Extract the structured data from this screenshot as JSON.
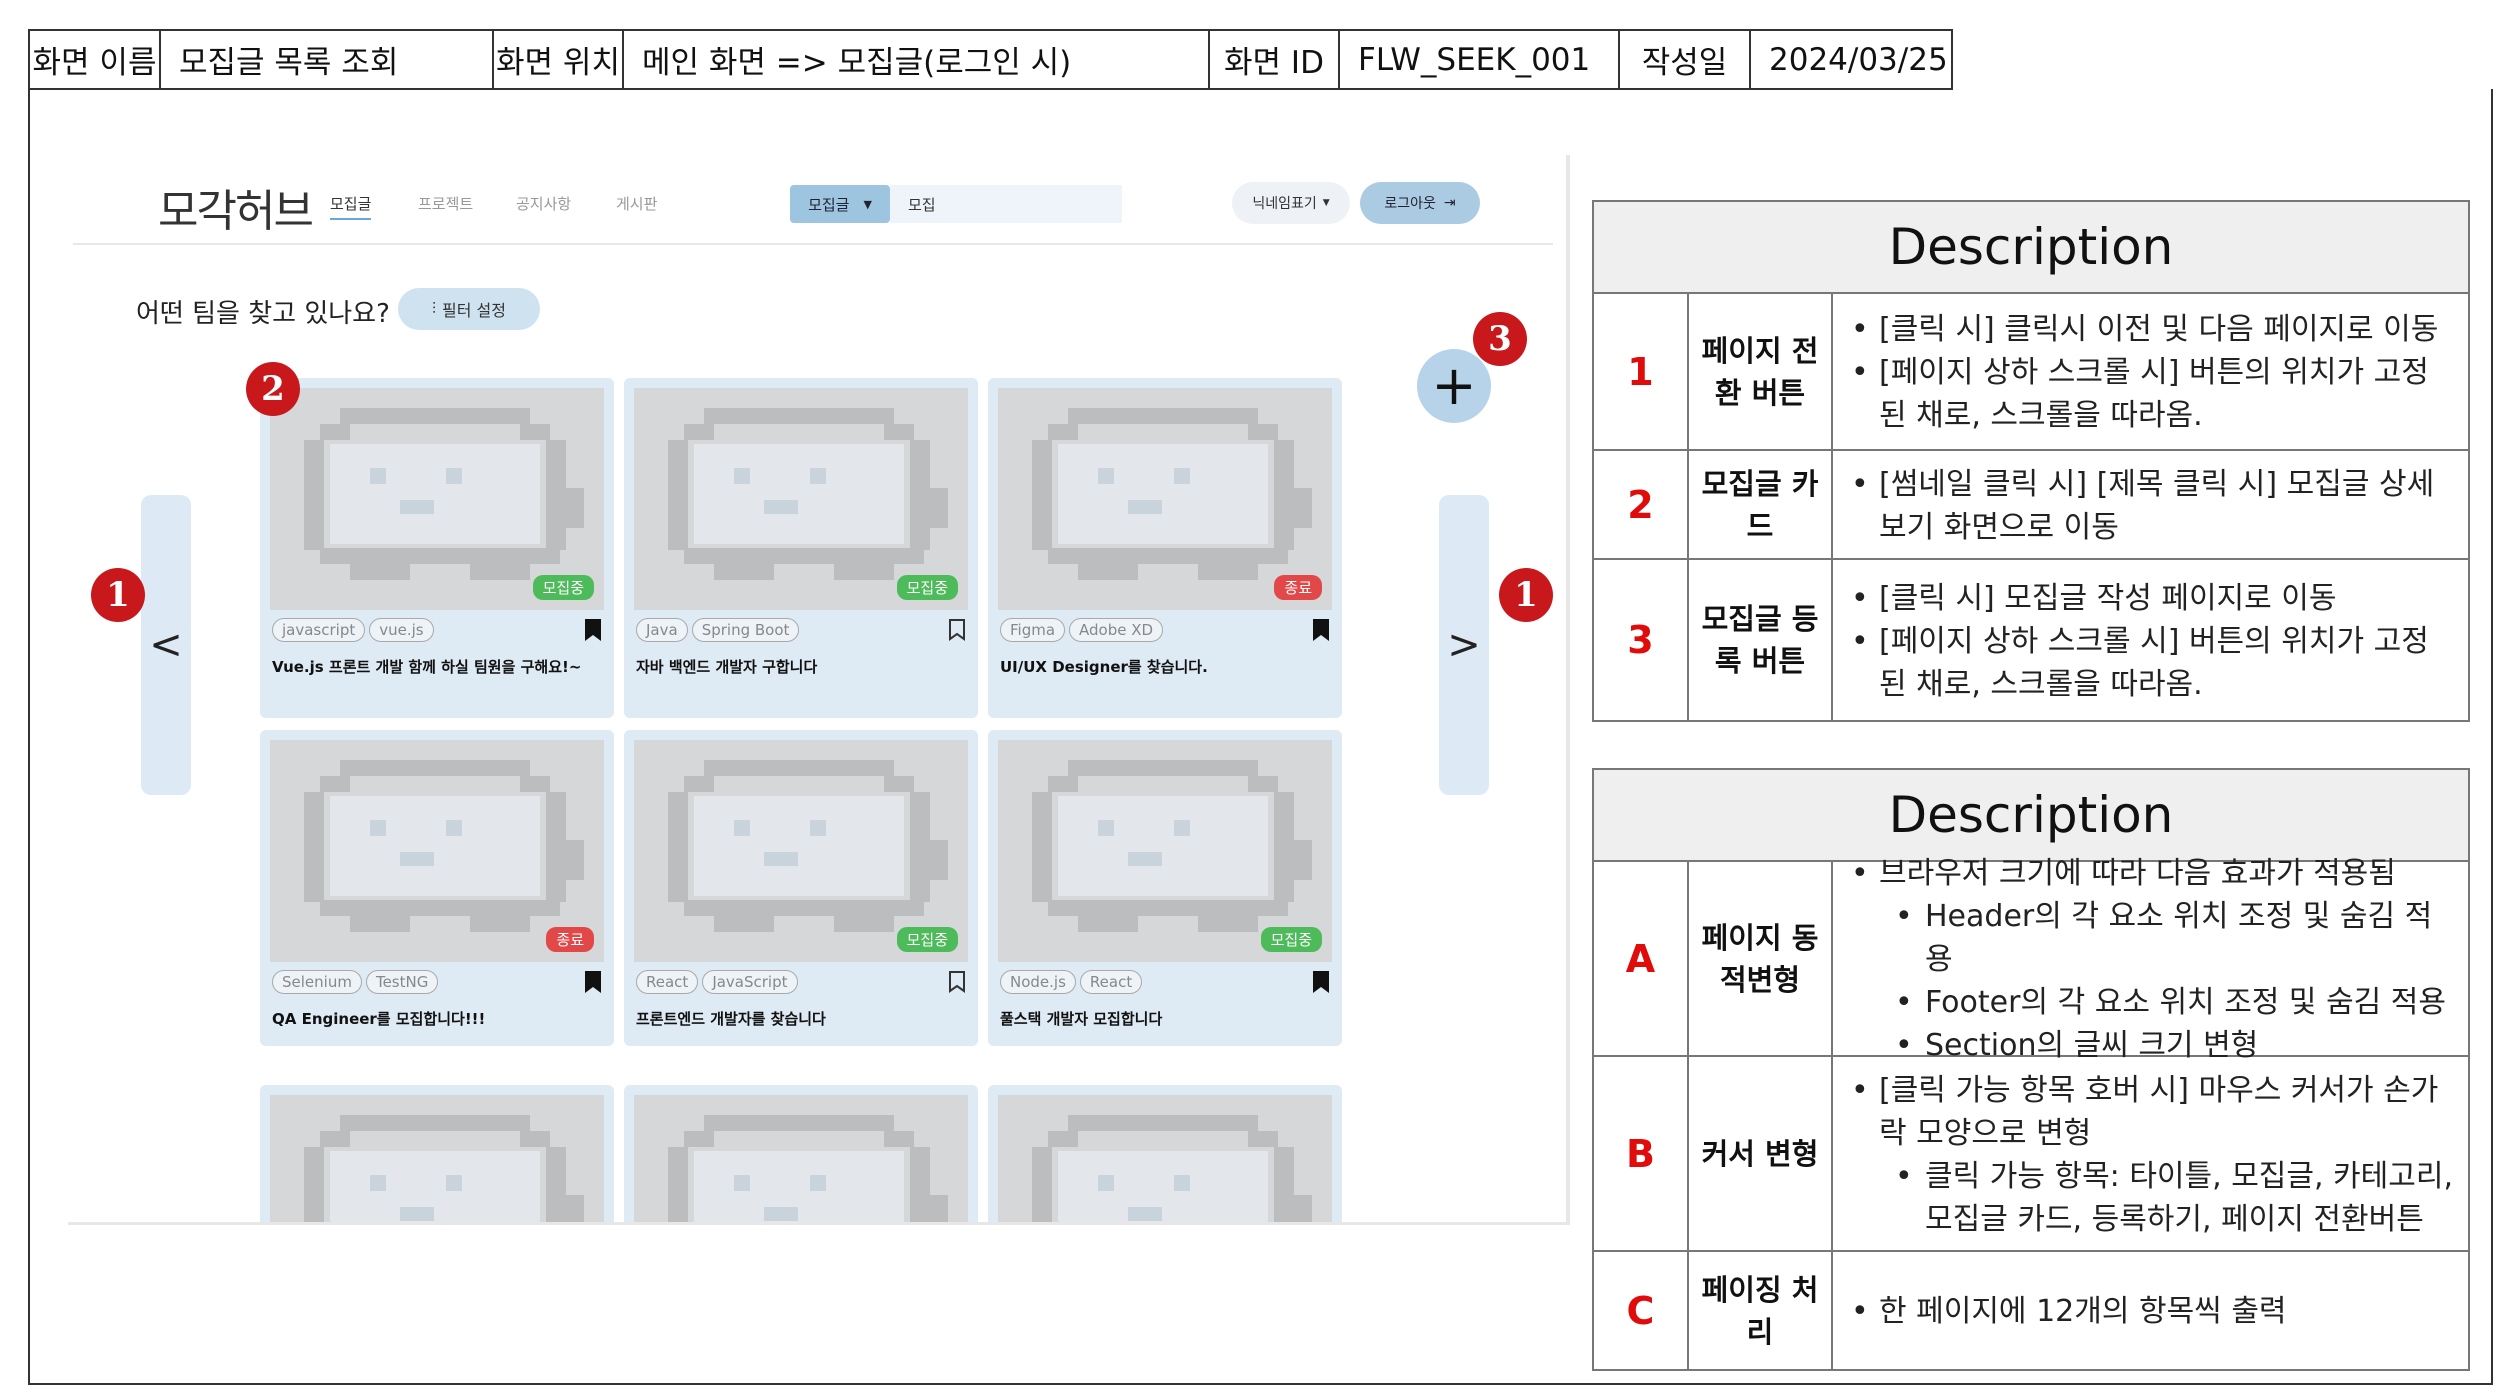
{
  "meta": {
    "name_label": "화면 이름",
    "name_value": "모집글 목록 조회",
    "location_label": "화면 위치",
    "location_value": "메인 화면 => 모집글(로그인 시)",
    "id_label": "화면 ID",
    "id_value": "FLW_SEEK_001",
    "date_label": "작성일",
    "date_value": "2024/03/25"
  },
  "mock": {
    "logo": "모각허브",
    "nav": [
      "모집글",
      "프로젝트",
      "공지사항",
      "게시판"
    ],
    "search_category": "모집글",
    "search_value": "모집",
    "nickname": "닉네임표기",
    "logout": "로그아웃",
    "prompt": "어떤 팀을 찾고 있나요?",
    "filter": "필터 설정",
    "prev": "<",
    "next": ">",
    "add": "+",
    "cards": [
      {
        "status": "모집중",
        "tags": [
          "javascript",
          "vue.js"
        ],
        "title": "Vue.js 프론트 개발 함께 하실 팀원을 구해요!~",
        "bookmarked": true
      },
      {
        "status": "모집중",
        "tags": [
          "Java",
          "Spring Boot"
        ],
        "title": "자바 백엔드 개발자 구합니다",
        "bookmarked": false
      },
      {
        "status": "종료",
        "tags": [
          "Figma",
          "Adobe XD"
        ],
        "title": "UI/UX Designer를 찾습니다.",
        "bookmarked": true
      },
      {
        "status": "종료",
        "tags": [
          "Selenium",
          "TestNG"
        ],
        "title": "QA Engineer를 모집합니다!!!",
        "bookmarked": true
      },
      {
        "status": "모집중",
        "tags": [
          "React",
          "JavaScript"
        ],
        "title": "프론트엔드 개발자를 찾습니다",
        "bookmarked": false
      },
      {
        "status": "모집중",
        "tags": [
          "Node.js",
          "React"
        ],
        "title": "풀스택 개발자 모집합니다",
        "bookmarked": true
      }
    ]
  },
  "markers": [
    "1",
    "2",
    "3",
    "1"
  ],
  "desc1": {
    "title": "Description",
    "rows": [
      {
        "num": "1",
        "name": "페이지 전환 버튼",
        "items": [
          "[클릭 시] 클릭시 이전 및 다음 페이지로 이동",
          "[페이지 상하 스크롤 시] 버튼의 위치가 고정된 채로, 스크롤을 따라옴."
        ]
      },
      {
        "num": "2",
        "name": "모집글 카드",
        "items": [
          "[썸네일 클릭 시] [제목 클릭 시] 모집글 상세보기 화면으로 이동"
        ]
      },
      {
        "num": "3",
        "name": "모집글 등록 버튼",
        "items": [
          "[클릭 시] 모집글 작성 페이지로 이동",
          "[페이지 상하 스크롤 시] 버튼의 위치가 고정된 채로, 스크롤을 따라옴."
        ]
      }
    ]
  },
  "desc2": {
    "title": "Description",
    "rows": [
      {
        "num": "A",
        "name": "페이지 동적변형",
        "items": [
          "브라우저 크기에 따라 다음 효과가 적용됨"
        ],
        "subitems": [
          "Header의 각 요소 위치 조정 및 숨김 적용",
          "Footer의 각 요소 위치 조정 및 숨김 적용",
          "Section의 글씨 크기 변형"
        ]
      },
      {
        "num": "B",
        "name": "커서 변형",
        "items": [
          "[클릭 가능 항목 호버 시] 마우스 커서가 손가락 모양으로 변형"
        ],
        "subitems": [
          "클릭 가능 항목: 타이틀, 모집글, 카테고리, 모집글 카드, 등록하기,  페이지 전환버튼"
        ]
      },
      {
        "num": "C",
        "name": "페이징 처리",
        "items": [
          "한 페이지에 12개의 항목씩 출력"
        ],
        "subitems": []
      }
    ]
  },
  "colors": {
    "accent_red": "#e00b0b",
    "marker_red": "#c8181b",
    "card_bg": "#deeaf4",
    "open_green": "#4dbb5a",
    "closed_red": "#e24848"
  }
}
